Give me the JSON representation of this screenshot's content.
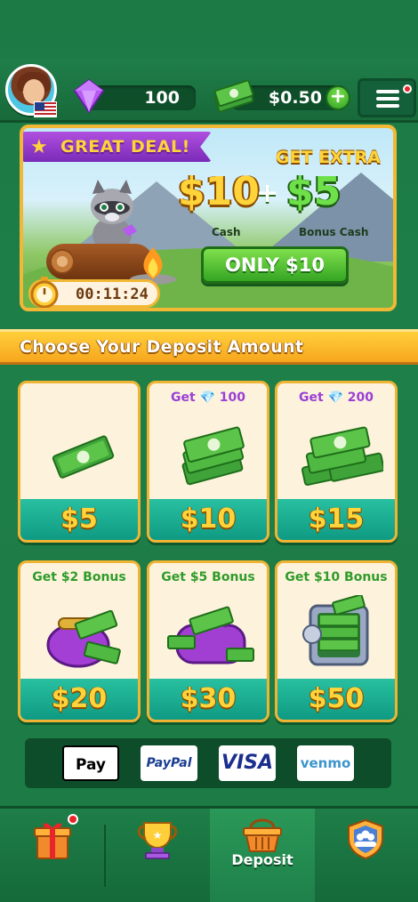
{
  "header": {
    "gems": "100",
    "cash": "$0.50",
    "add_label": "+"
  },
  "promo": {
    "badge": "GREAT DEAL!",
    "extra": "GET EXTRA",
    "cash_amount": "$10",
    "plus": "+",
    "bonus_amount": "$5",
    "cash_label": "Cash",
    "bonus_label": "Bonus Cash",
    "button_label": "ONLY $10",
    "timer": "00:11:24"
  },
  "section_title": "Choose Your Deposit Amount",
  "cards": [
    {
      "top": "",
      "price": "$5"
    },
    {
      "top": "Get 💎 100",
      "price": "$10"
    },
    {
      "top": "Get 💎 200",
      "price": "$15"
    },
    {
      "top": "Get $2 Bonus",
      "price": "$20"
    },
    {
      "top": "Get $5 Bonus",
      "price": "$30"
    },
    {
      "top": "Get $10 Bonus",
      "price": "$50"
    }
  ],
  "payments": {
    "applepay": " Pay",
    "paypal": "PayPal",
    "visa": "VISA",
    "venmo": "venmo"
  },
  "nav": {
    "deposit_label": "Deposit"
  },
  "colors": {
    "background": "#1d7a44",
    "accent_gold": "#ffd43a",
    "card_price_bg": "#0f9a83",
    "purple": "#9b3fd6"
  },
  "icons": [
    "avatar",
    "us-flag-icon",
    "gem-icon",
    "cash-stack-icon",
    "plus-icon",
    "menu-icon",
    "star-icon",
    "timer-icon",
    "gift-icon",
    "trophy-icon",
    "deposit-basket-icon",
    "team-shield-icon"
  ]
}
